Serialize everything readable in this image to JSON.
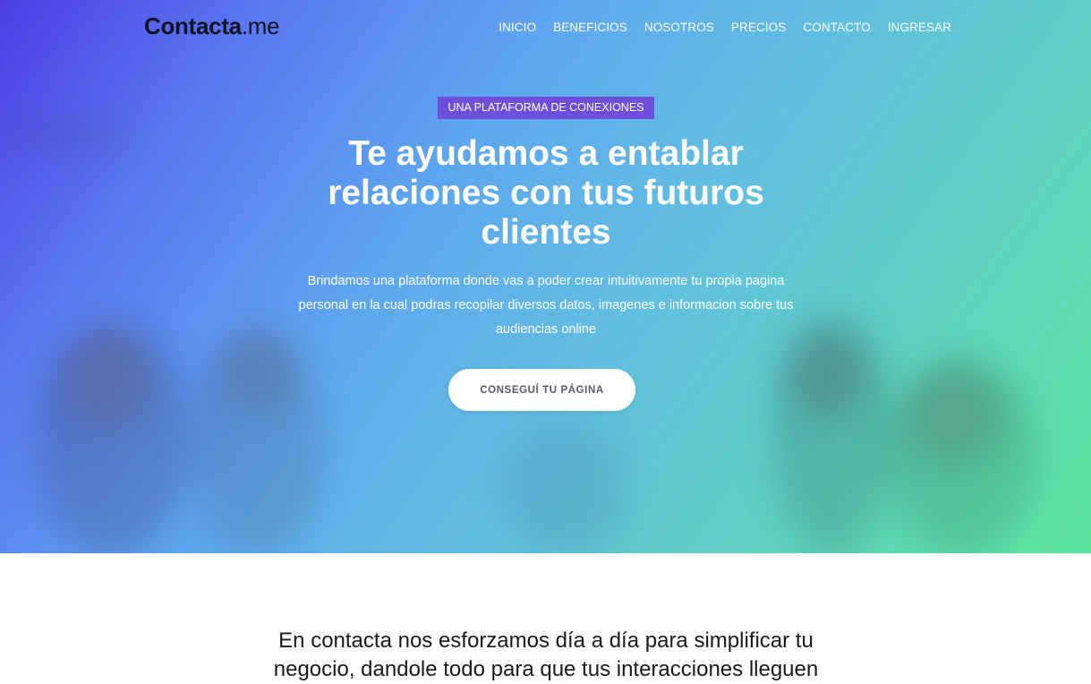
{
  "nav": {
    "logo_brand": "Contacta",
    "logo_tld": ".me",
    "items": [
      "INICIO",
      "BENEFICIOS",
      "NOSOTROS",
      "PRECIOS",
      "CONTACTO",
      "INGRESAR"
    ]
  },
  "hero": {
    "tagline": "UNA PLATAFORMA DE CONEXIONES",
    "headline": "Te ayudamos a entablar relaciones con tus futuros clientes",
    "description": "Brindamos una plataforma donde vas a poder crear intuitivamente tu propia pagina personal en la cual podras recopilar diversos datos, imagenes e informacion sobre tus audiencias online",
    "cta_label": "CONSEGUÍ TU PÁGINA"
  },
  "about": {
    "text": "En contacta nos esforzamos día a día para simplificar tu negocio, dandole todo para que tus interacciones lleguen"
  }
}
